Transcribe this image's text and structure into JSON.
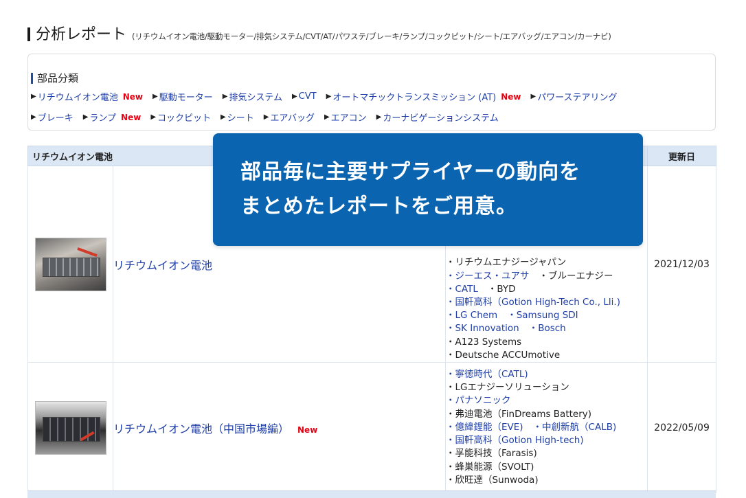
{
  "header": {
    "title": "分析レポート",
    "subtitle": "(リチウムイオン電池/駆動モーター/排気システム/CVT/AT/パワステ/ブレーキ/ランプ/コックピット/シート/エアバッグ/エアコン/カーナビ)"
  },
  "categories": {
    "heading": "部品分類",
    "row1": [
      {
        "label": "リチウムイオン電池",
        "badge": "New"
      },
      {
        "label": "駆動モーター"
      },
      {
        "label": "排気システム"
      },
      {
        "label": "CVT"
      },
      {
        "label": "オートマチックトランスミッション (AT)",
        "badge": "New"
      },
      {
        "label": "パワーステアリング"
      }
    ],
    "row2": [
      {
        "label": "ブレーキ"
      },
      {
        "label": "ランプ",
        "badge": "New"
      },
      {
        "label": "コックピット"
      },
      {
        "label": "シート"
      },
      {
        "label": "エアバッグ"
      },
      {
        "label": "エアコン"
      },
      {
        "label": "カーナビゲーションシステム"
      }
    ]
  },
  "table": {
    "header_category": "リチウムイオン電池",
    "header_date": "更新日",
    "rows": [
      {
        "name": "リチウムイオン電池",
        "badge": "",
        "date": "2021/12/03",
        "suppliers": [
          [
            {
              "t": "・リチウムエナジージャパン",
              "link": false
            }
          ],
          [
            {
              "t": "・ジーエス・ユアサ",
              "link": true
            },
            {
              "t": "・ブルーエナジー",
              "link": false
            }
          ],
          [
            {
              "t": "・CATL",
              "link": true
            },
            {
              "t": "・BYD",
              "link": false
            }
          ],
          [
            {
              "t": "・国軒高科（Gotion High-Tech Co., Lli.)",
              "link": true
            }
          ],
          [
            {
              "t": "・LG Chem",
              "link": true
            },
            {
              "t": "・Samsung SDI",
              "link": true
            }
          ],
          [
            {
              "t": "・SK Innovation",
              "link": true
            },
            {
              "t": "・Bosch",
              "link": true
            }
          ],
          [
            {
              "t": "・A123 Systems",
              "link": false
            }
          ],
          [
            {
              "t": "・Deutsche ACCUmotive",
              "link": false
            }
          ]
        ]
      },
      {
        "name": "リチウムイオン電池（中国市場編）",
        "badge": "New",
        "date": "2022/05/09",
        "suppliers": [
          [
            {
              "t": "・寧徳時代（CATL)",
              "link": true
            }
          ],
          [
            {
              "t": "・LGエナジーソリューション",
              "link": false
            }
          ],
          [
            {
              "t": "・パナソニック",
              "link": true
            }
          ],
          [
            {
              "t": "・弗迪電池（FinDreams Battery)",
              "link": false
            }
          ],
          [
            {
              "t": "・億緯鋰能（EVE)",
              "link": true
            },
            {
              "t": "・中創新航（CALB)",
              "link": true
            }
          ],
          [
            {
              "t": "・国軒高科（Gotion High-tech)",
              "link": true
            }
          ],
          [
            {
              "t": "・孚能科技（Farasis)",
              "link": false
            }
          ],
          [
            {
              "t": "・蜂巣能源（SVOLT)",
              "link": false
            }
          ],
          [
            {
              "t": "・欣旺達（Sunwoda)",
              "link": false
            }
          ]
        ]
      }
    ]
  },
  "overlay": {
    "line1": "部品毎に主要サプライヤーの動向を",
    "line2": "まとめたレポートをご用意。"
  },
  "colors": {
    "link": "#1f3fa8",
    "new_badge": "#e60012",
    "overlay_bg": "#0a64b0",
    "table_header": "#dbe7f5"
  }
}
